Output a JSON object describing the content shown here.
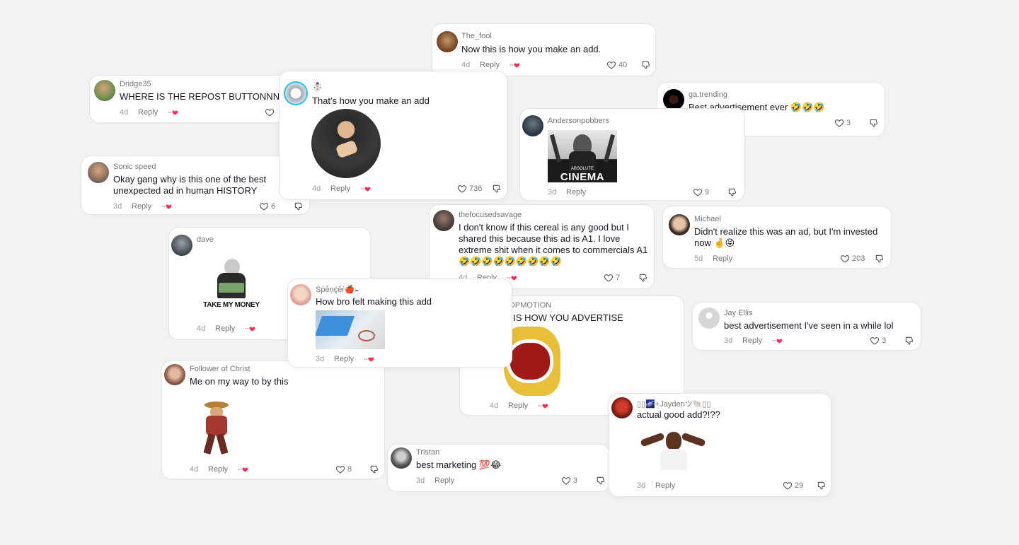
{
  "colors": {
    "background": "#f3f2f1",
    "card": "#ffffff",
    "heart_accent": "#fe2c55",
    "muted": "#75767a"
  },
  "comments": [
    {
      "id": "thefool",
      "username": "The_fool",
      "text": "Now this is how you make an add.",
      "age": "4d",
      "reply": "Reply",
      "likes": "40"
    },
    {
      "id": "dridge",
      "username": "Dridge35",
      "text": "WHERE IS THE REPOST BUTTONNNN",
      "age": "4d",
      "reply": "Reply",
      "likes": ""
    },
    {
      "id": "gatrending",
      "username": "ga.trending",
      "text": "Best advertisement ever 🤣🤣🤣",
      "age": "",
      "reply": "",
      "likes": "3"
    },
    {
      "id": "snowman",
      "username": "☃️",
      "text": "That's how you make an add",
      "age": "4d",
      "reply": "Reply",
      "likes": "736"
    },
    {
      "id": "anderson",
      "username": "Andersonpobbers",
      "text": "",
      "sticker_caption_small": "ABSOLUTE",
      "sticker_caption": "CINEMA",
      "age": "3d",
      "reply": "Reply",
      "likes": "9"
    },
    {
      "id": "sonic",
      "username": "Sonic speed",
      "text": "Okay gang why is this one of the best unexpected ad in human HISTORY",
      "age": "3d",
      "reply": "Reply",
      "likes": "6"
    },
    {
      "id": "focused",
      "username": "thefocusedsavage",
      "text": "I don't know if this cereal is any good but I shared this because this ad is A1. I love extreme shit when it comes to commercials A1 🤣🤣🤣🤣🤣🤣🤣🤣🤣",
      "age": "4d",
      "reply": "Reply",
      "likes": "7"
    },
    {
      "id": "michael",
      "username": "Michael",
      "text": "Didn't realize this was an ad, but I'm invested now 🤞😝",
      "age": "5d",
      "reply": "Reply",
      "likes": "203"
    },
    {
      "id": "dave",
      "username": "dave",
      "text": "",
      "sticker_caption": "TAKE MY MONEY",
      "age": "4d",
      "reply": "Reply",
      "likes": ""
    },
    {
      "id": "spencer",
      "username": "Ṩṗḗṇḉḗṙ🍎◒",
      "text": "How bro felt making this add",
      "age": "3d",
      "reply": "Reply",
      "likes": ""
    },
    {
      "id": "lsstop",
      "username": "LSSTOPMOTION",
      "text": "THIS IS HOW YOU ADVERTISE",
      "age": "4d",
      "reply": "Reply",
      "likes": ""
    },
    {
      "id": "jayellis",
      "username": "Jay Ellis",
      "text": "best advertisement I've seen in a while lol",
      "age": "3d",
      "reply": "Reply",
      "likes": "3"
    },
    {
      "id": "follower",
      "username": "Follower of Christ",
      "text": "Me on my way to by this",
      "age": "4d",
      "reply": "Reply",
      "likes": "8"
    },
    {
      "id": "tristan",
      "username": "Tristan",
      "text": "best marketing 💯😂",
      "age": "3d",
      "reply": "Reply",
      "likes": "3"
    },
    {
      "id": "jayden",
      "username": "▯▯🌌+Jaydenツ🐚▯▯",
      "text": "actual good add?!??",
      "age": "3d",
      "reply": "Reply",
      "likes": "29"
    }
  ]
}
